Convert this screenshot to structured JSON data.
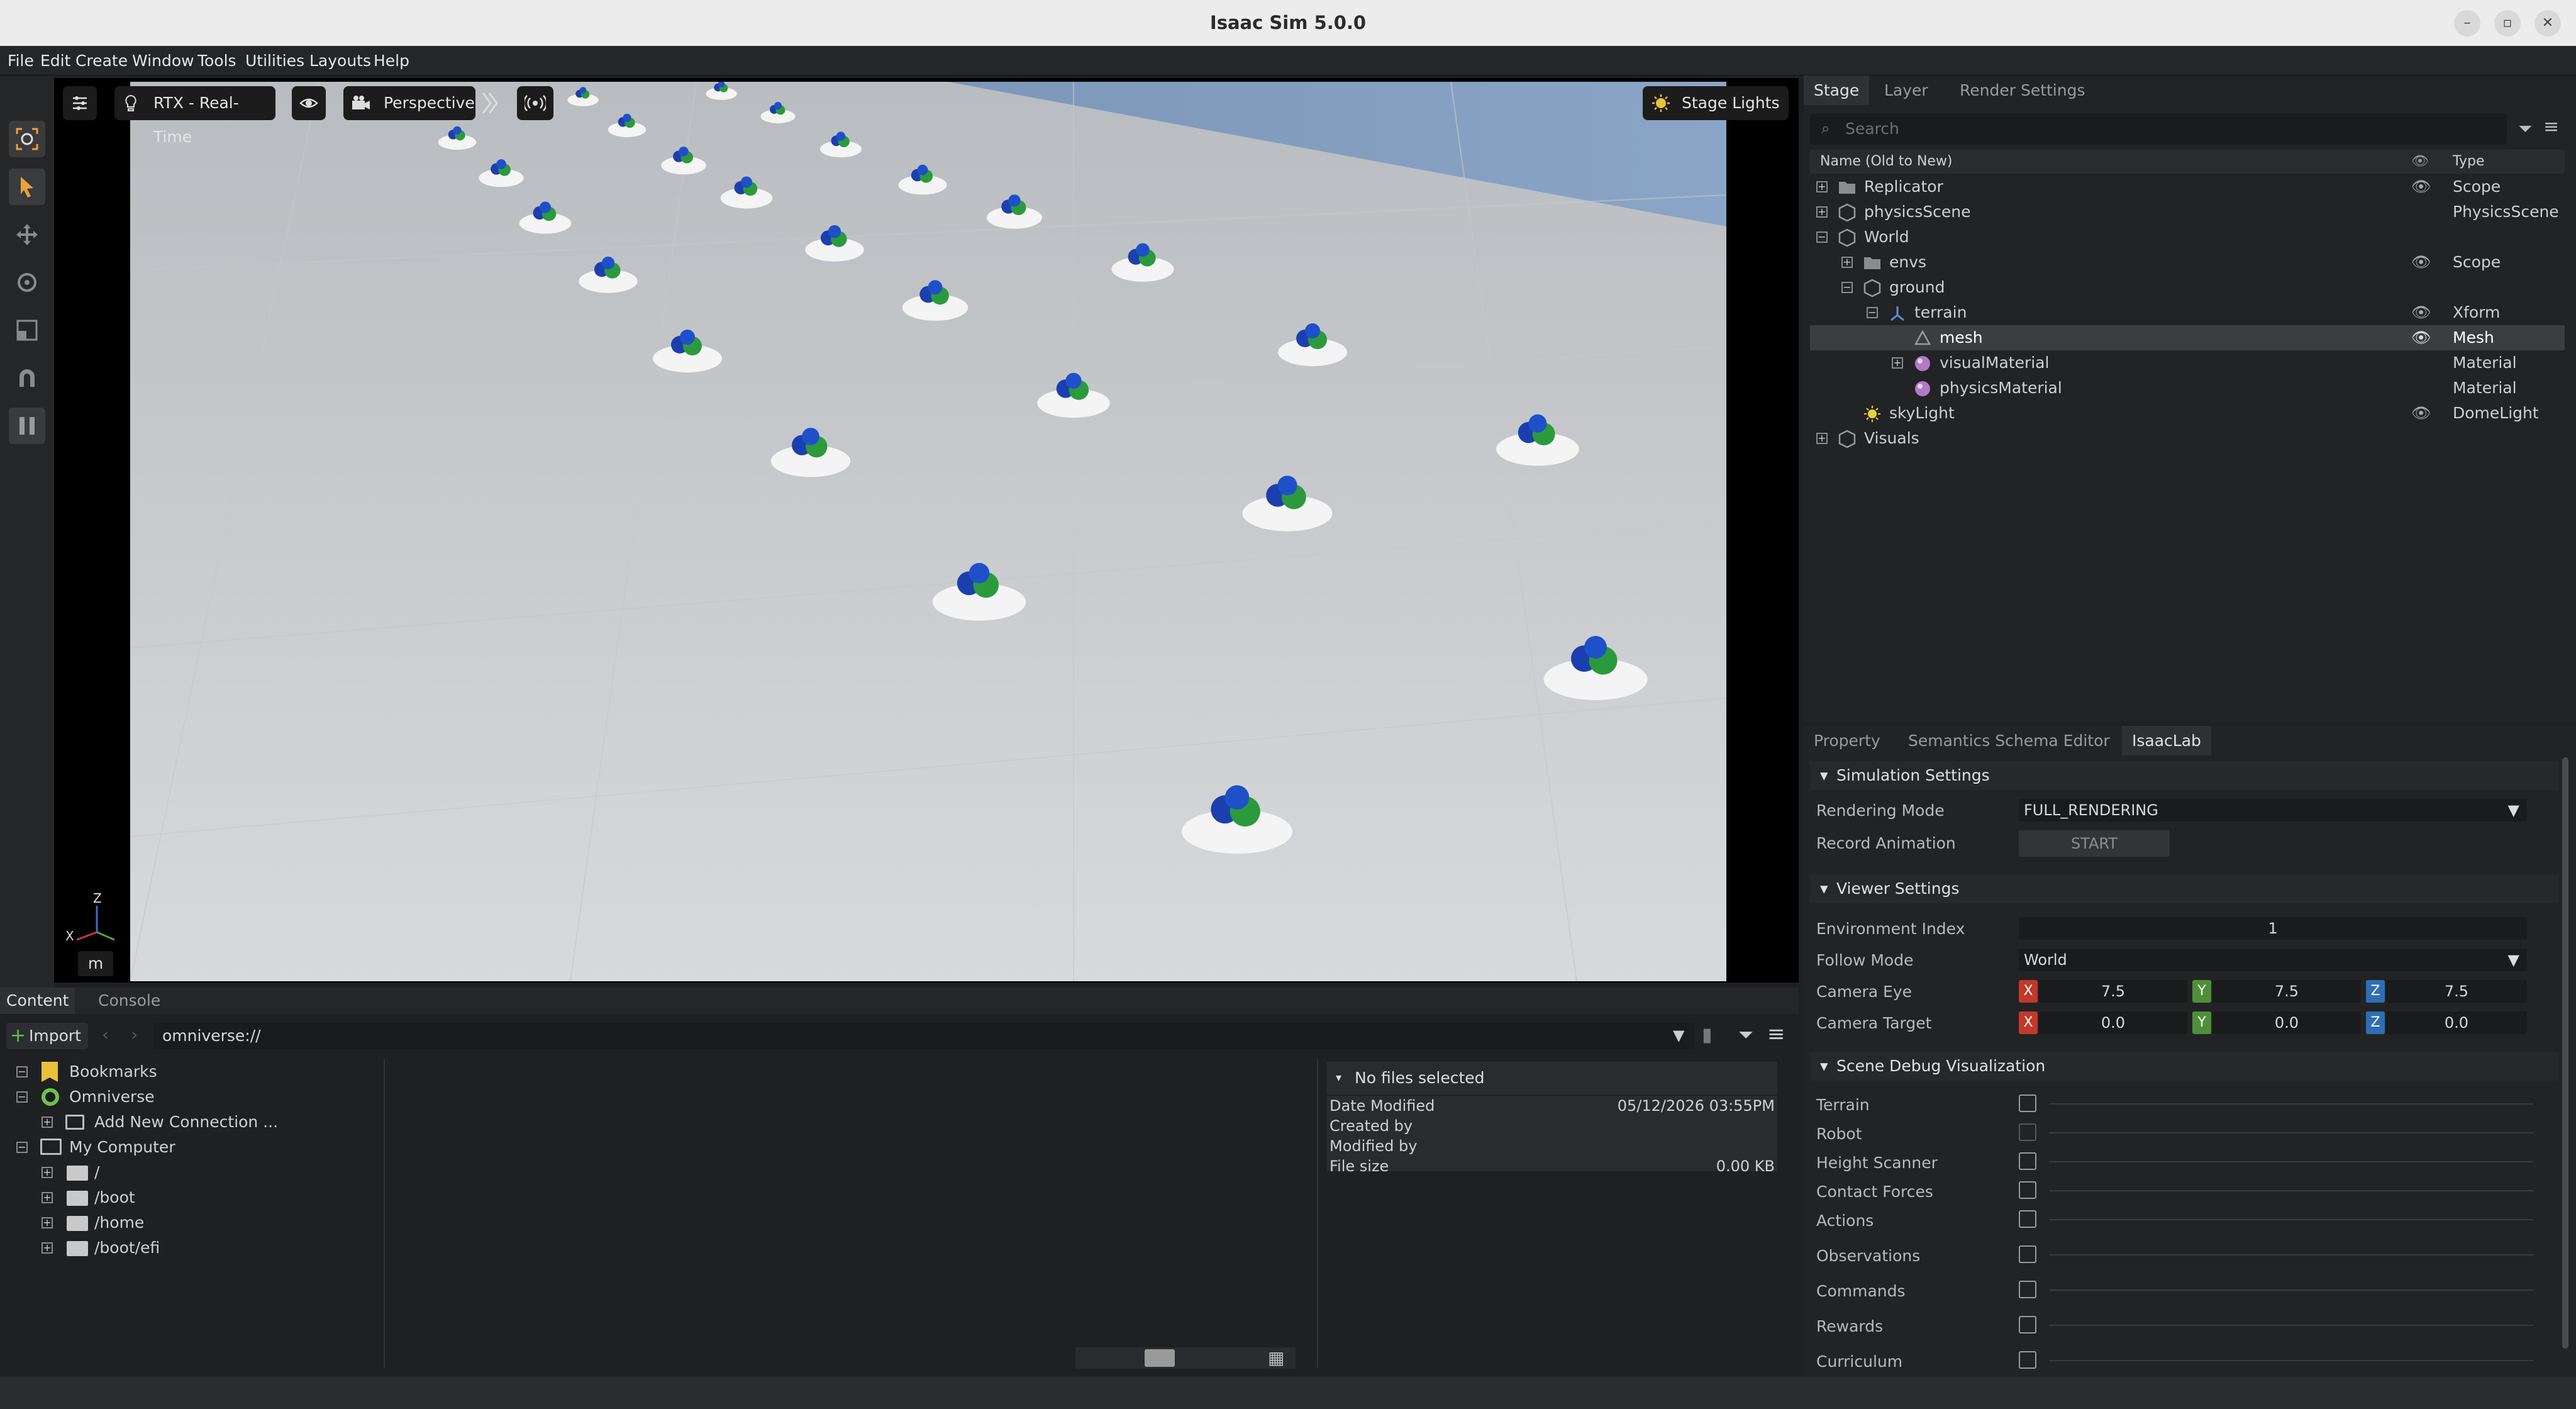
{
  "window": {
    "title": "Isaac Sim 5.0.0"
  },
  "menu": [
    "File",
    "Edit",
    "Create",
    "Window",
    "Tools",
    "Utilities",
    "Layouts",
    "Help"
  ],
  "viewport": {
    "renderer": "RTX - Real-Time",
    "camera": "Perspective",
    "lights": "Stage Lights",
    "units": "m",
    "axis_x": "X",
    "axis_z": "Z"
  },
  "stage_panel": {
    "tabs": [
      "Stage",
      "Layer",
      "Render Settings"
    ],
    "search_placeholder": "Search",
    "header_name": "Name (Old to New)",
    "header_type": "Type",
    "rows": [
      {
        "name": "Replicator",
        "type": "Scope",
        "visible": true
      },
      {
        "name": "physicsScene",
        "type": "PhysicsScene",
        "visible": false
      },
      {
        "name": "World",
        "type": "",
        "visible": false
      },
      {
        "name": "envs",
        "type": "Scope",
        "visible": true
      },
      {
        "name": "ground",
        "type": "",
        "visible": false
      },
      {
        "name": "terrain",
        "type": "Xform",
        "visible": true
      },
      {
        "name": "mesh",
        "type": "Mesh",
        "visible": true,
        "selected": true
      },
      {
        "name": "visualMaterial",
        "type": "Material",
        "visible": false
      },
      {
        "name": "physicsMaterial",
        "type": "Material",
        "visible": false
      },
      {
        "name": "skyLight",
        "type": "DomeLight",
        "visible": true
      },
      {
        "name": "Visuals",
        "type": "",
        "visible": false
      }
    ]
  },
  "property_panel": {
    "tabs": [
      "Property",
      "Semantics Schema Editor",
      "IsaacLab"
    ],
    "simulation": {
      "title": "Simulation Settings",
      "rendering_mode_label": "Rendering Mode",
      "rendering_mode_value": "FULL_RENDERING",
      "record_animation_label": "Record Animation",
      "start_button": "START"
    },
    "viewer": {
      "title": "Viewer Settings",
      "env_index_label": "Environment Index",
      "env_index_value": "1",
      "follow_mode_label": "Follow Mode",
      "follow_mode_value": "World",
      "camera_eye_label": "Camera Eye",
      "camera_eye": [
        "7.5",
        "7.5",
        "7.5"
      ],
      "camera_target_label": "Camera Target",
      "camera_target": [
        "0.0",
        "0.0",
        "0.0"
      ],
      "axis_labels": [
        "X",
        "Y",
        "Z"
      ]
    },
    "debug": {
      "title": "Scene Debug Visualization",
      "items": [
        "Terrain",
        "Robot",
        "Height Scanner",
        "Contact Forces",
        "Actions",
        "Observations",
        "Commands",
        "Rewards",
        "Curriculum"
      ]
    }
  },
  "content_panel": {
    "tabs": [
      "Content",
      "Console"
    ],
    "import_label": "Import",
    "path": "omniverse://",
    "tree": [
      {
        "label": "Bookmarks"
      },
      {
        "label": "Omniverse"
      },
      {
        "label": "Add New Connection ..."
      },
      {
        "label": "My Computer"
      },
      {
        "label": "/"
      },
      {
        "label": "/boot"
      },
      {
        "label": "/home"
      },
      {
        "label": "/boot/efi"
      }
    ],
    "info": {
      "header": "No files selected",
      "date_modified_label": "Date Modified",
      "date_modified_value": "05/12/2026 03:55PM",
      "created_by_label": "Created by",
      "modified_by_label": "Modified by",
      "file_size_label": "File size",
      "file_size_value": "0.00 KB"
    }
  },
  "colors": {
    "accent": "#e8a33a",
    "axis_x": "#c0392b",
    "axis_y": "#4f8f3a",
    "axis_z": "#2f6db5"
  }
}
